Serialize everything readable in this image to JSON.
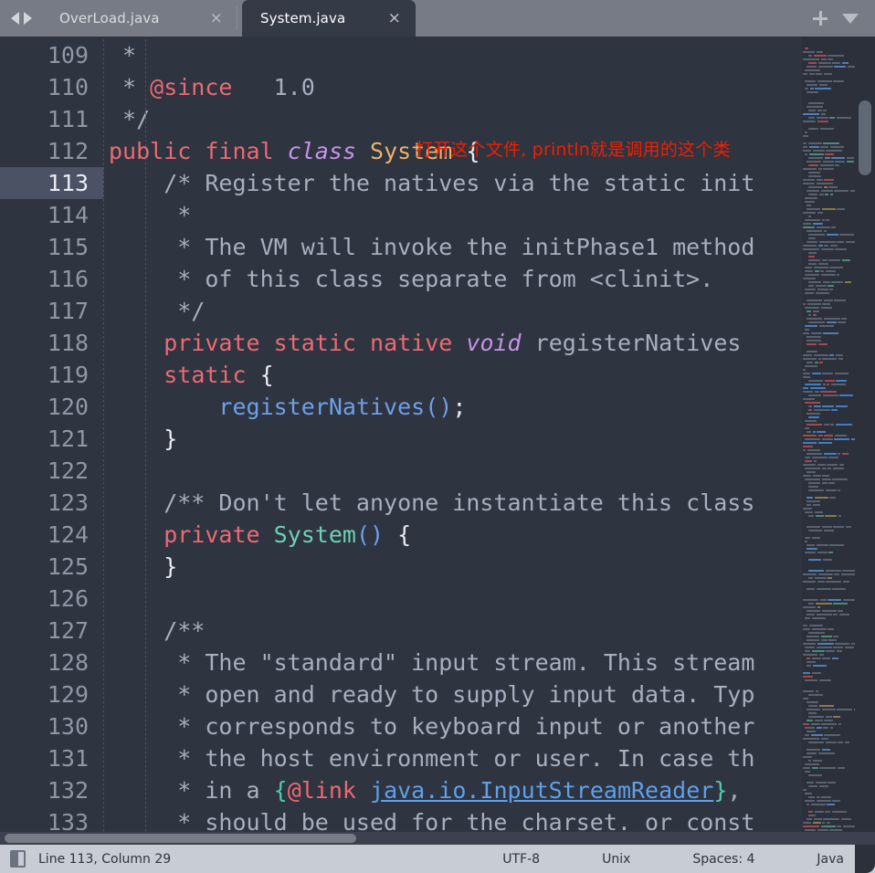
{
  "window": {
    "title": "System.java"
  },
  "tabbar": {
    "nav_back_icon": "triangle-left-icon",
    "nav_forward_icon": "triangle-right-icon",
    "add_label": "+",
    "dropdown_icon": "chevron-down-icon",
    "close_glyph": "×",
    "tabs": [
      {
        "label": "OverLoad.java",
        "active": false
      },
      {
        "label": "System.java",
        "active": true
      }
    ]
  },
  "editor": {
    "first_line": 109,
    "current_line": 113,
    "annotation": "打开这个文件, println就是调用的这个类",
    "annotation_color": "#f01f00",
    "lines": [
      {
        "n": 109,
        "text": " *"
      },
      {
        "n": 110,
        "text": " * @since   1.0"
      },
      {
        "n": 111,
        "text": " */"
      },
      {
        "n": 112,
        "text": "public final class System {"
      },
      {
        "n": 113,
        "text": "    /* Register the natives via the static init"
      },
      {
        "n": 114,
        "text": "     *"
      },
      {
        "n": 115,
        "text": "     * The VM will invoke the initPhase1 method"
      },
      {
        "n": 116,
        "text": "     * of this class separate from <clinit>."
      },
      {
        "n": 117,
        "text": "     */"
      },
      {
        "n": 118,
        "text": "    private static native void registerNatives"
      },
      {
        "n": 119,
        "text": "    static {"
      },
      {
        "n": 120,
        "text": "        registerNatives();"
      },
      {
        "n": 121,
        "text": "    }"
      },
      {
        "n": 122,
        "text": ""
      },
      {
        "n": 123,
        "text": "    /** Don't let anyone instantiate this class"
      },
      {
        "n": 124,
        "text": "    private System() {"
      },
      {
        "n": 125,
        "text": "    }"
      },
      {
        "n": 126,
        "text": ""
      },
      {
        "n": 127,
        "text": "    /**"
      },
      {
        "n": 128,
        "text": "     * The \"standard\" input stream. This stream"
      },
      {
        "n": 129,
        "text": "     * open and ready to supply input data. Typ"
      },
      {
        "n": 130,
        "text": "     * corresponds to keyboard input or another"
      },
      {
        "n": 131,
        "text": "     * the host environment or user. In case th"
      },
      {
        "n": 132,
        "text": "     * in a {@link java.io.InputStreamReader},"
      },
      {
        "n": 133,
        "text": "     * should be used for the charset. or const"
      }
    ],
    "colors": {
      "background": "#2e3440",
      "line_number": "#8f97a5",
      "current_line_bg": "#4a5263",
      "comment": "#a7b0bf",
      "keyword": "#ec6a73",
      "keyword_italic": "#c792ea",
      "type": "#ecb36b",
      "function_decl": "#6fd0b5",
      "function_call": "#6f9fe8",
      "javadoc_brace": "#53c8b0",
      "javadoc_tag": "#ec6a73",
      "javadoc_link": "#5fa0e8",
      "punctuation": "#e8ecf2"
    }
  },
  "statusbar": {
    "panel_icon": "panel-layout-icon",
    "position": "Line 113, Column 29",
    "encoding": "UTF-8",
    "line_ending": "Unix",
    "indentation": "Spaces: 4",
    "language": "Java"
  }
}
